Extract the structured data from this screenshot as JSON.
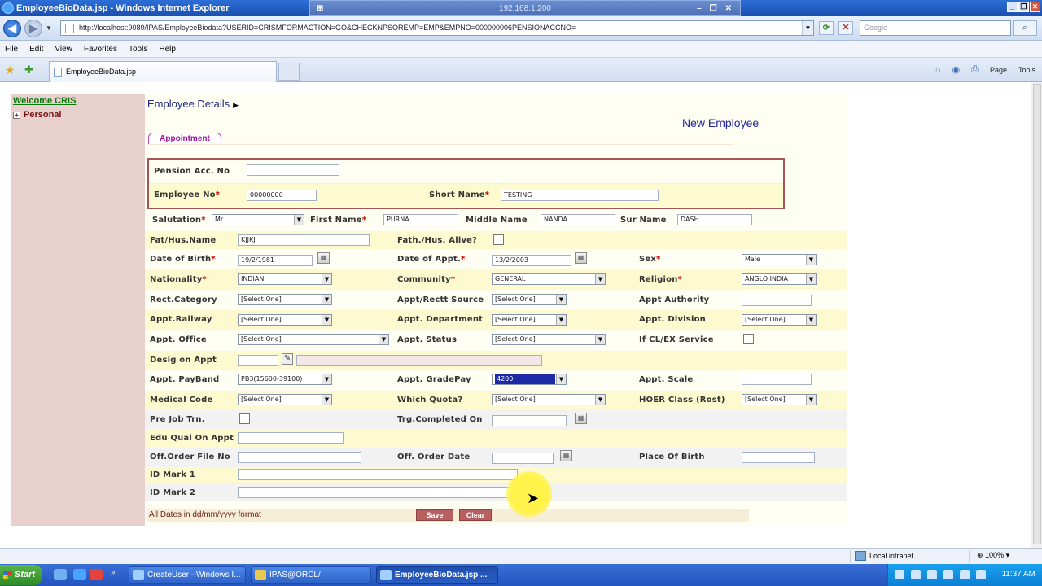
{
  "window": {
    "title": "EmployeeBioData.jsp - Windows Internet Explorer",
    "rdp_host": "192.168.1.200"
  },
  "address": {
    "url": "http://localhost:9080/IPAS/EmployeeBiodata?USERID=CRISMFORMACTION=GO&CHECKNPSOREMP=EMP&EMPNO=000000006PENSIONACCNO=",
    "search_placeholder": "Google"
  },
  "menu": [
    "File",
    "Edit",
    "View",
    "Favorites",
    "Tools",
    "Help"
  ],
  "tab": {
    "label": "EmployeeBioData.jsp"
  },
  "commands": {
    "page": "Page",
    "tools": "Tools"
  },
  "sidebar": {
    "welcome": "Welcome CRIS",
    "personal": "Personal"
  },
  "page": {
    "breadcrumb": "Employee Details",
    "subtitle": "New Employee",
    "tab_label": "Appointment"
  },
  "form": {
    "pension_acc_label": "Pension Acc. No",
    "pension_acc_value": "",
    "employee_no_label": "Employee No",
    "employee_no_value": "00000000",
    "short_name_label": "Short Name",
    "short_name_value": "TESTING",
    "salutation_label": "Salutation",
    "salutation_value": "Mr",
    "first_name_label": "First Name",
    "first_name_value": "PURNA",
    "middle_name_label": "Middle Name",
    "middle_name_value": "NANDA",
    "sur_name_label": "Sur Name",
    "sur_name_value": "DASH",
    "fat_hus_name_label": "Fat/Hus.Name",
    "fat_hus_name_value": "KJJKJ",
    "fath_alive_label": "Fath./Hus. Alive?",
    "dob_label": "Date of Birth",
    "dob_value": "19/2/1981",
    "doa_label": "Date of Appt.",
    "doa_value": "13/2/2003",
    "sex_label": "Sex",
    "sex_value": "Male",
    "nationality_label": "Nationality",
    "nationality_value": "INDIAN",
    "community_label": "Community",
    "community_value": "GENERAL",
    "religion_label": "Religion",
    "religion_value": "ANGLO INDIA",
    "rect_category_label": "Rect.Category",
    "rect_category_value": "[Select One]",
    "appt_rectt_source_label": "Appt/Rectt Source",
    "appt_rectt_source_value": "[Select One]",
    "appt_authority_label": "Appt Authority",
    "appt_railway_label": "Appt.Railway",
    "appt_railway_value": "[Select One]",
    "appt_department_label": "Appt. Department",
    "appt_department_value": "[Select One]",
    "appt_division_label": "Appt. Division",
    "appt_division_value": "[Select One]",
    "appt_office_label": "Appt. Office",
    "appt_office_value": "[Select One]",
    "appt_status_label": "Appt. Status",
    "appt_status_value": "[Select One]",
    "cl_ex_label": "If CL/EX Service",
    "desig_label": "Desig on Appt",
    "payband_label": "Appt. PayBand",
    "payband_value": "PB3(15600-39100)",
    "gradepay_label": "Appt. GradePay",
    "gradepay_value": "4200",
    "scale_label": "Appt. Scale",
    "medical_code_label": "Medical Code",
    "medical_code_value": "[Select One]",
    "quota_label": "Which Quota?",
    "quota_value": "[Select One]",
    "hoer_label": "HOER Class (Rost)",
    "hoer_value": "[Select One]",
    "pre_job_label": "Pre Job Trn.",
    "trg_completed_label": "Trg.Completed On",
    "edu_qual_label": "Edu Qual On Appt",
    "off_order_file_label": "Off.Order File No",
    "off_order_date_label": "Off. Order Date",
    "place_birth_label": "Place Of Birth",
    "id_mark1_label": "ID Mark 1",
    "id_mark2_label": "ID Mark 2",
    "dates_note": "All Dates in dd/mm/yyyy format",
    "save_label": "Save",
    "clear_label": "Clear",
    "required_mark": "*"
  },
  "status": {
    "zone": "Local intranet",
    "zoom": "100%"
  },
  "taskbar": {
    "start": "Start",
    "tasks": [
      "CreateUser - Windows I...",
      "IPAS@ORCL/",
      "EmployeeBioData.jsp ..."
    ],
    "clock": "11:37 AM"
  },
  "colors": {
    "accent": "#2d6fd6",
    "sidebar": "#e7d0cd",
    "required": "#cc0000",
    "button": "#b86060"
  }
}
